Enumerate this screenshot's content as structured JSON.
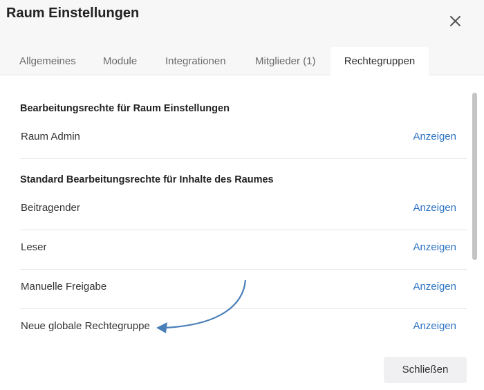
{
  "dialog": {
    "title": "Raum Einstellungen",
    "close_icon": "close-icon"
  },
  "tabs": [
    {
      "label": "Allgemeines"
    },
    {
      "label": "Module"
    },
    {
      "label": "Integrationen"
    },
    {
      "label": "Mitglieder (1)"
    },
    {
      "label": "Rechtegruppen",
      "active": true
    }
  ],
  "sections": [
    {
      "title": "Bearbeitungsrechte für Raum Einstellungen",
      "rows": [
        {
          "label": "Raum Admin",
          "action": "Anzeigen"
        }
      ]
    },
    {
      "title": "Standard Bearbeitungsrechte für Inhalte des Raumes",
      "rows": [
        {
          "label": "Beitragender",
          "action": "Anzeigen"
        },
        {
          "label": "Leser",
          "action": "Anzeigen"
        },
        {
          "label": "Manuelle Freigabe",
          "action": "Anzeigen"
        },
        {
          "label": "Neue globale Rechtegruppe",
          "action": "Anzeigen"
        }
      ]
    }
  ],
  "footer": {
    "close_label": "Schließen"
  },
  "colors": {
    "link": "#2d73c4",
    "annotation_arrow": "#4a7fb8"
  }
}
